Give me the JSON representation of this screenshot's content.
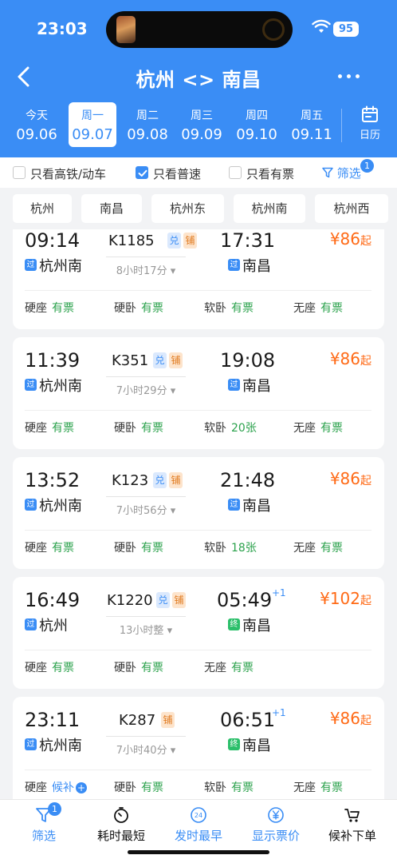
{
  "status_bar": {
    "time": "23:03",
    "battery": "95"
  },
  "nav": {
    "title": "杭州 <> 南昌"
  },
  "dates": [
    {
      "week": "今天",
      "date": "09.06",
      "active": false
    },
    {
      "week": "周一",
      "date": "09.07",
      "active": true
    },
    {
      "week": "周二",
      "date": "09.08",
      "active": false
    },
    {
      "week": "周三",
      "date": "09.09",
      "active": false
    },
    {
      "week": "周四",
      "date": "09.10",
      "active": false
    },
    {
      "week": "周五",
      "date": "09.11",
      "active": false
    }
  ],
  "calendar_label": "日历",
  "filters": {
    "high_speed": {
      "label": "只看高铁/动车",
      "checked": false
    },
    "normal": {
      "label": "只看普速",
      "checked": true
    },
    "available": {
      "label": "只看有票",
      "checked": false
    },
    "filter_label": "筛选",
    "filter_badge": "1"
  },
  "stations": [
    "杭州",
    "南昌",
    "杭州东",
    "杭州南",
    "杭州西"
  ],
  "colors": {
    "brand": "#3a8df5",
    "price": "#ff6a16",
    "available": "#2ba24c",
    "terminal": "#2bbf6a"
  },
  "trains": [
    {
      "dep_time": "09:14",
      "train_no": "K1185",
      "tags": [
        "兑",
        "铺"
      ],
      "arr_time": "17:31",
      "next_day": "",
      "price": "¥86",
      "price_suffix": "起",
      "duration": "8小时17分",
      "from_icon": "过",
      "from": "杭州南",
      "to_icon": "过",
      "to": "南昌",
      "seats": [
        {
          "type": "硬座",
          "status": "有票"
        },
        {
          "type": "硬卧",
          "status": "有票"
        },
        {
          "type": "软卧",
          "status": "有票"
        },
        {
          "type": "无座",
          "status": "有票"
        }
      ]
    },
    {
      "dep_time": "11:39",
      "train_no": "K351",
      "tags": [
        "兑",
        "铺"
      ],
      "arr_time": "19:08",
      "next_day": "",
      "price": "¥86",
      "price_suffix": "起",
      "duration": "7小时29分",
      "from_icon": "过",
      "from": "杭州南",
      "to_icon": "过",
      "to": "南昌",
      "seats": [
        {
          "type": "硬座",
          "status": "有票"
        },
        {
          "type": "硬卧",
          "status": "有票"
        },
        {
          "type": "软卧",
          "status": "20张"
        },
        {
          "type": "无座",
          "status": "有票"
        }
      ]
    },
    {
      "dep_time": "13:52",
      "train_no": "K123",
      "tags": [
        "兑",
        "铺"
      ],
      "arr_time": "21:48",
      "next_day": "",
      "price": "¥86",
      "price_suffix": "起",
      "duration": "7小时56分",
      "from_icon": "过",
      "from": "杭州南",
      "to_icon": "过",
      "to": "南昌",
      "seats": [
        {
          "type": "硬座",
          "status": "有票"
        },
        {
          "type": "硬卧",
          "status": "有票"
        },
        {
          "type": "软卧",
          "status": "18张"
        },
        {
          "type": "无座",
          "status": "有票"
        }
      ]
    },
    {
      "dep_time": "16:49",
      "train_no": "K1220",
      "tags": [
        "兑",
        "铺"
      ],
      "arr_time": "05:49",
      "next_day": "+1",
      "price": "¥102",
      "price_suffix": "起",
      "duration": "13小时整",
      "from_icon": "过",
      "from": "杭州",
      "to_icon": "终",
      "to": "南昌",
      "seats": [
        {
          "type": "硬座",
          "status": "有票"
        },
        {
          "type": "硬卧",
          "status": "有票"
        },
        {
          "type": "无座",
          "status": "有票"
        }
      ]
    },
    {
      "dep_time": "23:11",
      "train_no": "K287",
      "tags": [
        "铺"
      ],
      "arr_time": "06:51",
      "next_day": "+1",
      "price": "¥86",
      "price_suffix": "起",
      "duration": "7小时40分",
      "from_icon": "过",
      "from": "杭州南",
      "to_icon": "终",
      "to": "南昌",
      "seats": [
        {
          "type": "硬座",
          "status": "候补",
          "waitlist": true
        },
        {
          "type": "硬卧",
          "status": "有票"
        },
        {
          "type": "软卧",
          "status": "有票"
        },
        {
          "type": "无座",
          "status": "有票"
        }
      ]
    }
  ],
  "toolbar": [
    {
      "label": "筛选",
      "icon": "funnel-icon",
      "badge": "1"
    },
    {
      "label": "耗时最短",
      "icon": "stopwatch-icon"
    },
    {
      "label": "发时最早",
      "icon": "clock-24-icon"
    },
    {
      "label": "显示票价",
      "icon": "yuan-icon"
    },
    {
      "label": "候补下单",
      "icon": "cart-icon"
    }
  ]
}
